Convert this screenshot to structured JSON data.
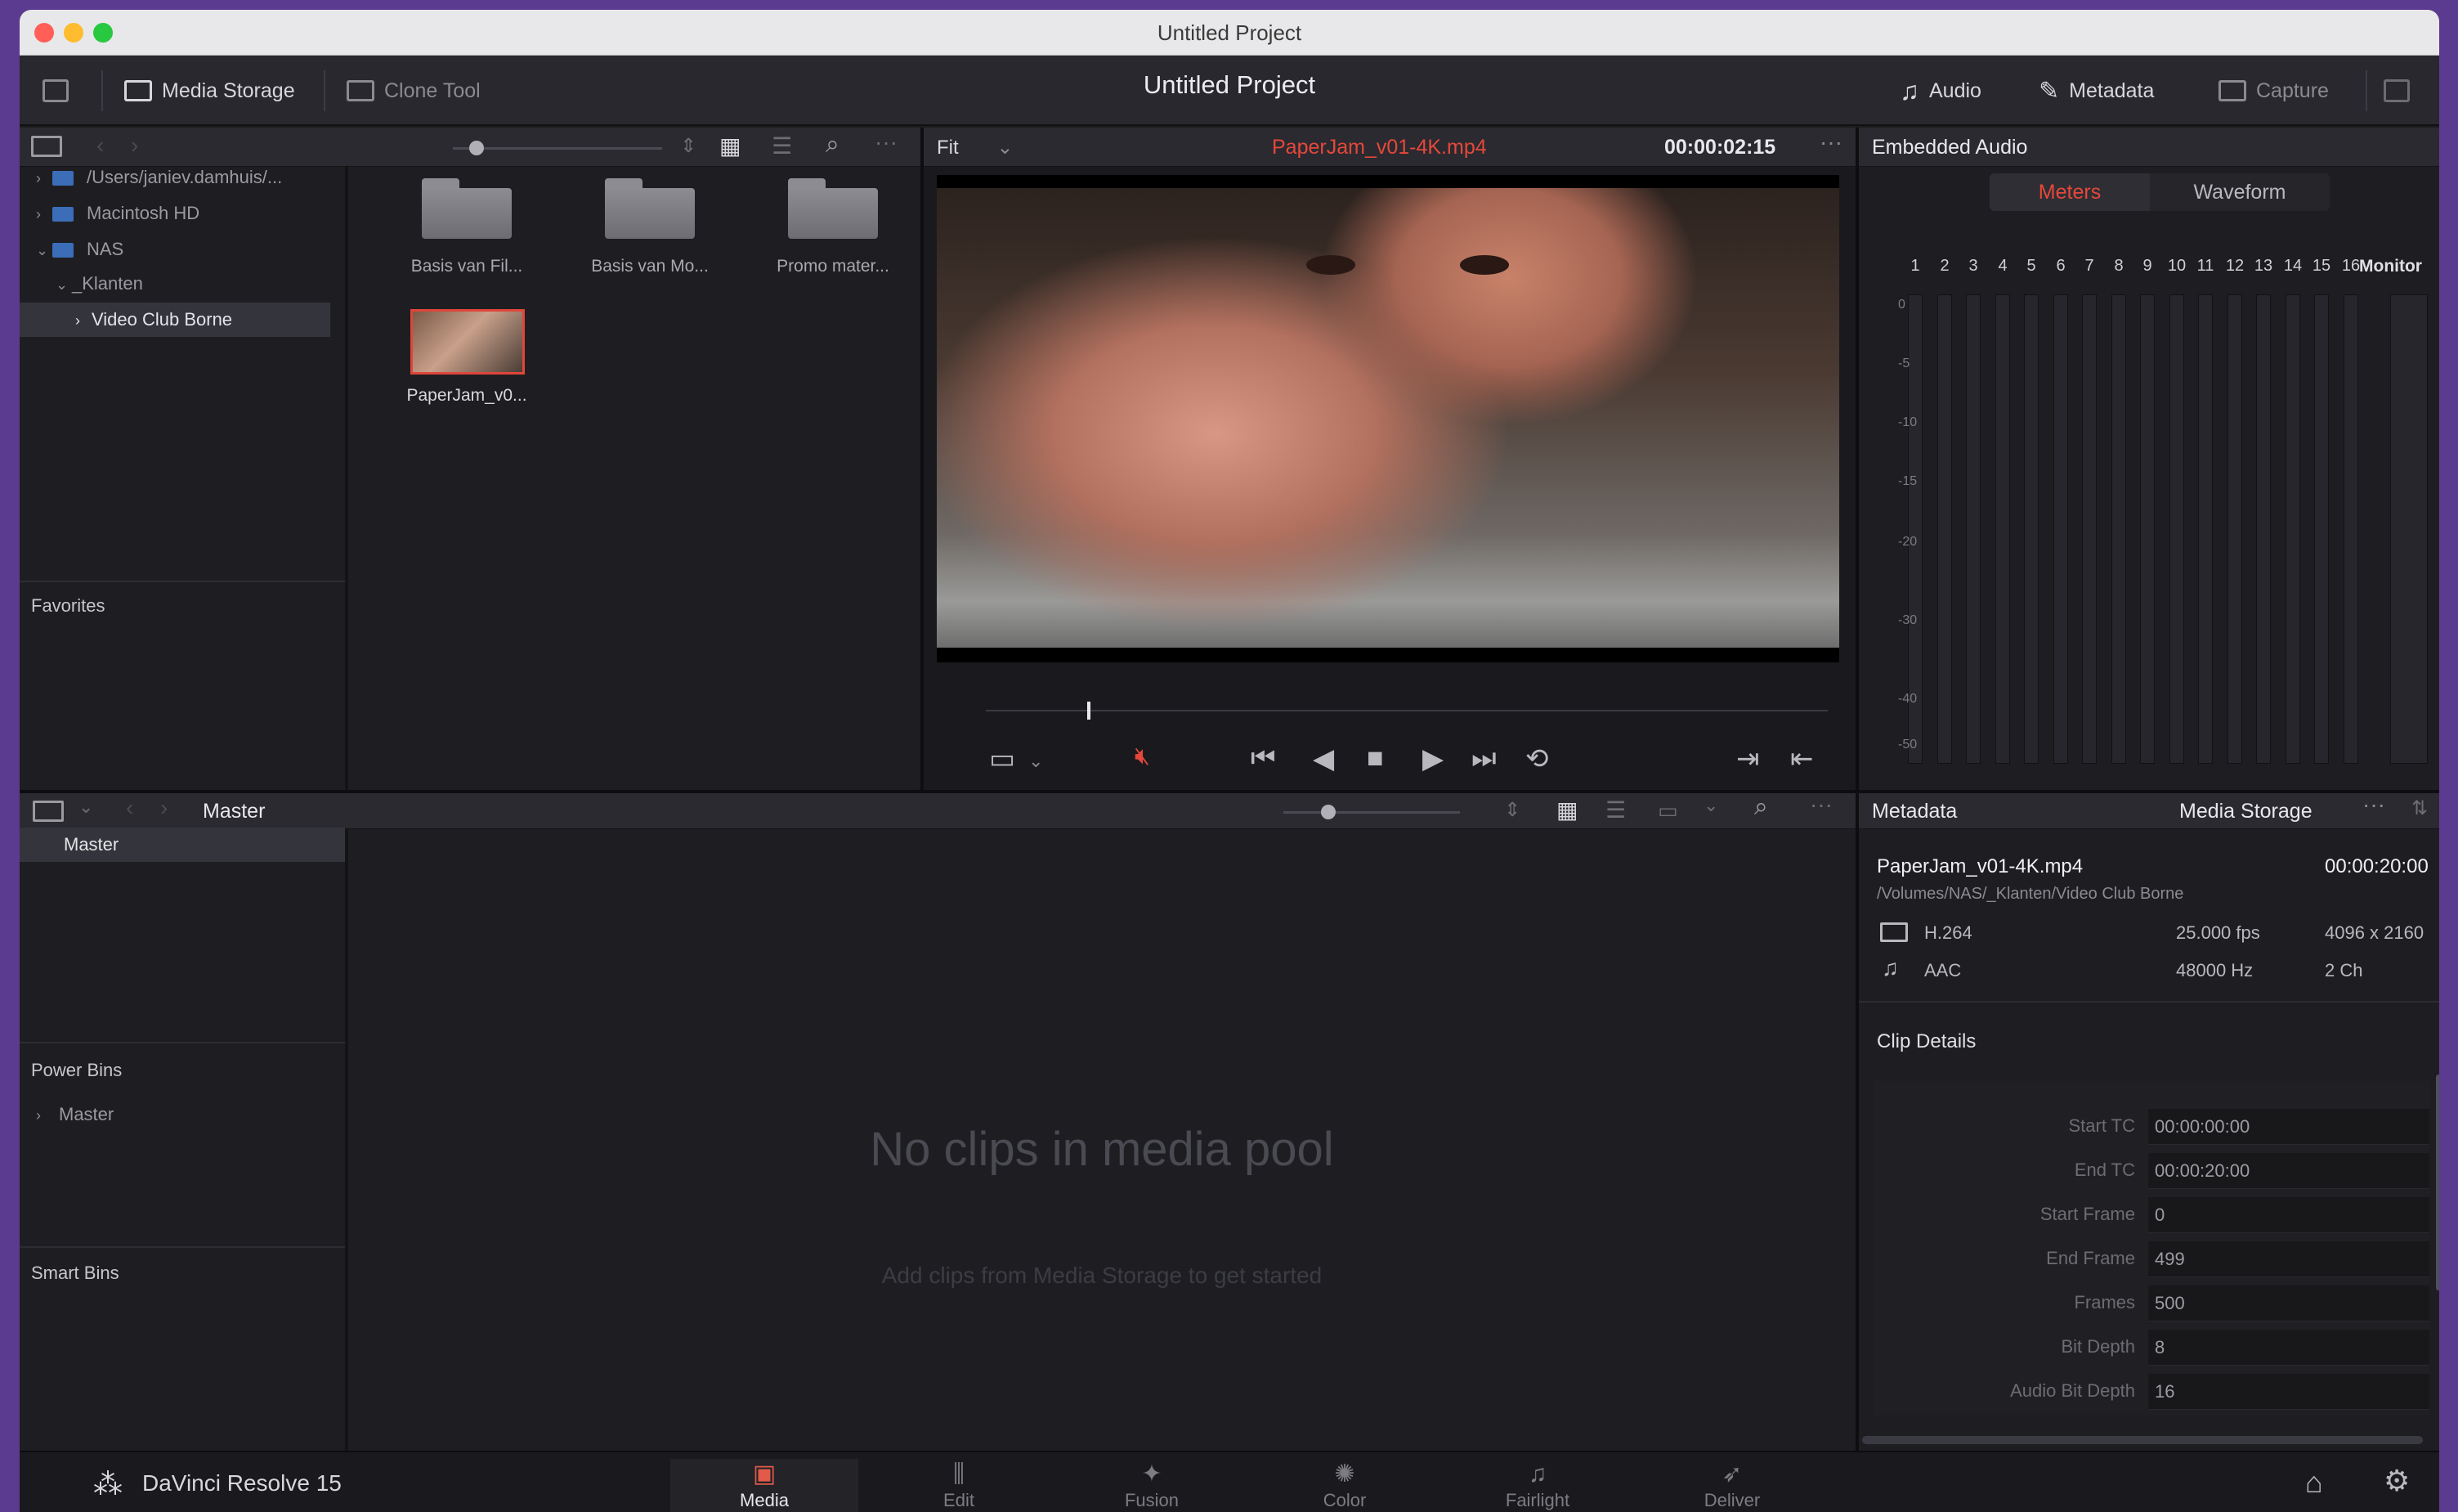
{
  "window": {
    "title": "Untitled Project"
  },
  "toolbar": {
    "media_storage": "Media Storage",
    "clone_tool": "Clone Tool",
    "project_title": "Untitled Project",
    "audio": "Audio",
    "metadata": "Metadata",
    "capture": "Capture"
  },
  "storage": {
    "tree": [
      {
        "label": "/Users/janiev.damhuis/..."
      },
      {
        "label": "Macintosh HD"
      },
      {
        "label": "NAS"
      },
      {
        "label": "_Klanten"
      },
      {
        "label": "Video Club Borne"
      }
    ],
    "favorites": "Favorites",
    "items": [
      {
        "label": "Basis van Fil..."
      },
      {
        "label": "Basis van Mo..."
      },
      {
        "label": "Promo mater..."
      },
      {
        "label": "PaperJam_v0..."
      }
    ]
  },
  "viewer": {
    "zoom": "Fit",
    "clip_name": "PaperJam_v01-4K.mp4",
    "timecode": "00:00:02:15",
    "scrub_position": 0.12
  },
  "audio_panel": {
    "title": "Embedded Audio",
    "tab_meters": "Meters",
    "tab_waveform": "Waveform",
    "channels": [
      "1",
      "2",
      "3",
      "4",
      "5",
      "6",
      "7",
      "8",
      "9",
      "10",
      "11",
      "12",
      "13",
      "14",
      "15",
      "16"
    ],
    "monitor": "Monitor",
    "db_scale": [
      "0",
      "-5",
      "-10",
      "-15",
      "-20",
      "-30",
      "-40",
      "-50"
    ]
  },
  "media_pool": {
    "bin_label": "Master",
    "master_bin": "Master",
    "power_bins": "Power Bins",
    "power_master": "Master",
    "smart_bins": "Smart Bins",
    "empty_title": "No clips in media pool",
    "empty_sub": "Add clips from Media Storage to get started"
  },
  "metadata_panel": {
    "tab_metadata": "Metadata",
    "tab_storage": "Media Storage",
    "file_name": "PaperJam_v01-4K.mp4",
    "duration": "00:00:20:00",
    "path": "/Volumes/NAS/_Klanten/Video Club Borne",
    "video_codec": "H.264",
    "fps": "25.000 fps",
    "resolution": "4096 x 2160",
    "audio_codec": "AAC",
    "sample_rate": "48000 Hz",
    "audio_channels": "2 Ch",
    "clip_details": "Clip Details",
    "details": [
      {
        "label": "Start TC",
        "value": "00:00:00:00"
      },
      {
        "label": "End TC",
        "value": "00:00:20:00"
      },
      {
        "label": "Start Frame",
        "value": "0"
      },
      {
        "label": "End Frame",
        "value": "499"
      },
      {
        "label": "Frames",
        "value": "500"
      },
      {
        "label": "Bit Depth",
        "value": "8"
      },
      {
        "label": "Audio Bit Depth",
        "value": "16"
      }
    ]
  },
  "pages": {
    "app_name": "DaVinci Resolve 15",
    "media": "Media",
    "edit": "Edit",
    "fusion": "Fusion",
    "color": "Color",
    "fairlight": "Fairlight",
    "deliver": "Deliver"
  },
  "colors": {
    "accent": "#e15a4a",
    "background": "#1e1e22",
    "desktop": "#5b3b8f"
  }
}
